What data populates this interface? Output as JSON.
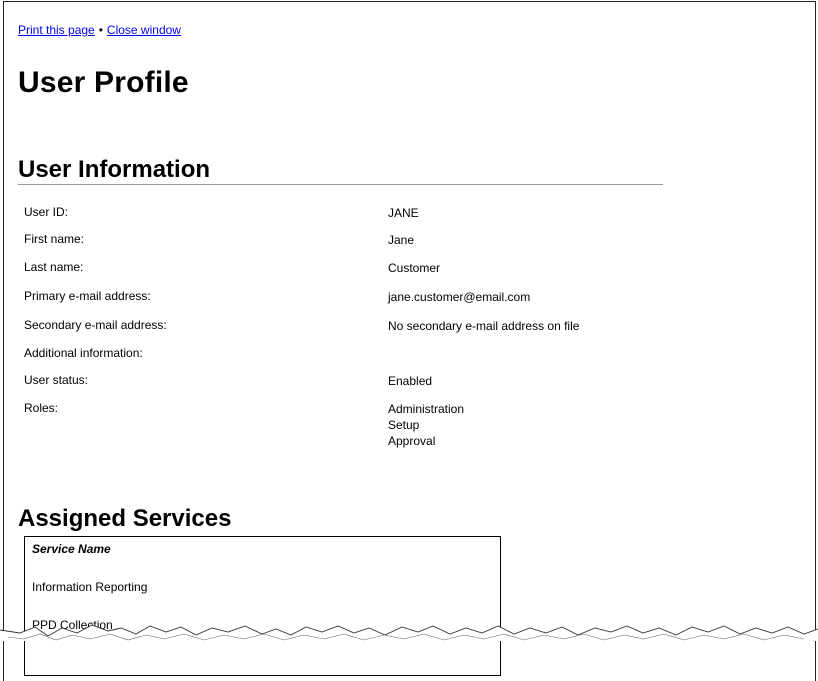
{
  "links": {
    "print": "Print this page",
    "separator": "•",
    "close": "Close window"
  },
  "page_title": "User Profile",
  "user_information": {
    "title": "User Information",
    "rows": [
      {
        "label": "User ID:",
        "value": "JANE"
      },
      {
        "label": "First name:",
        "value": "Jane"
      },
      {
        "label": "Last name:",
        "value": "Customer"
      },
      {
        "label": "Primary e-mail address:",
        "value": "jane.customer@email.com"
      },
      {
        "label": "Secondary e-mail address:",
        "value": "No secondary e-mail address on file"
      },
      {
        "label": "Additional information:",
        "value": ""
      },
      {
        "label": "User status:",
        "value": "Enabled"
      },
      {
        "label": "Roles:",
        "value": "Administration"
      }
    ],
    "roles_extra": [
      "Setup",
      "Approval"
    ]
  },
  "assigned_services": {
    "title": "Assigned Services",
    "header": "Service Name",
    "items": [
      "Information Reporting",
      "PPD Collection"
    ]
  }
}
